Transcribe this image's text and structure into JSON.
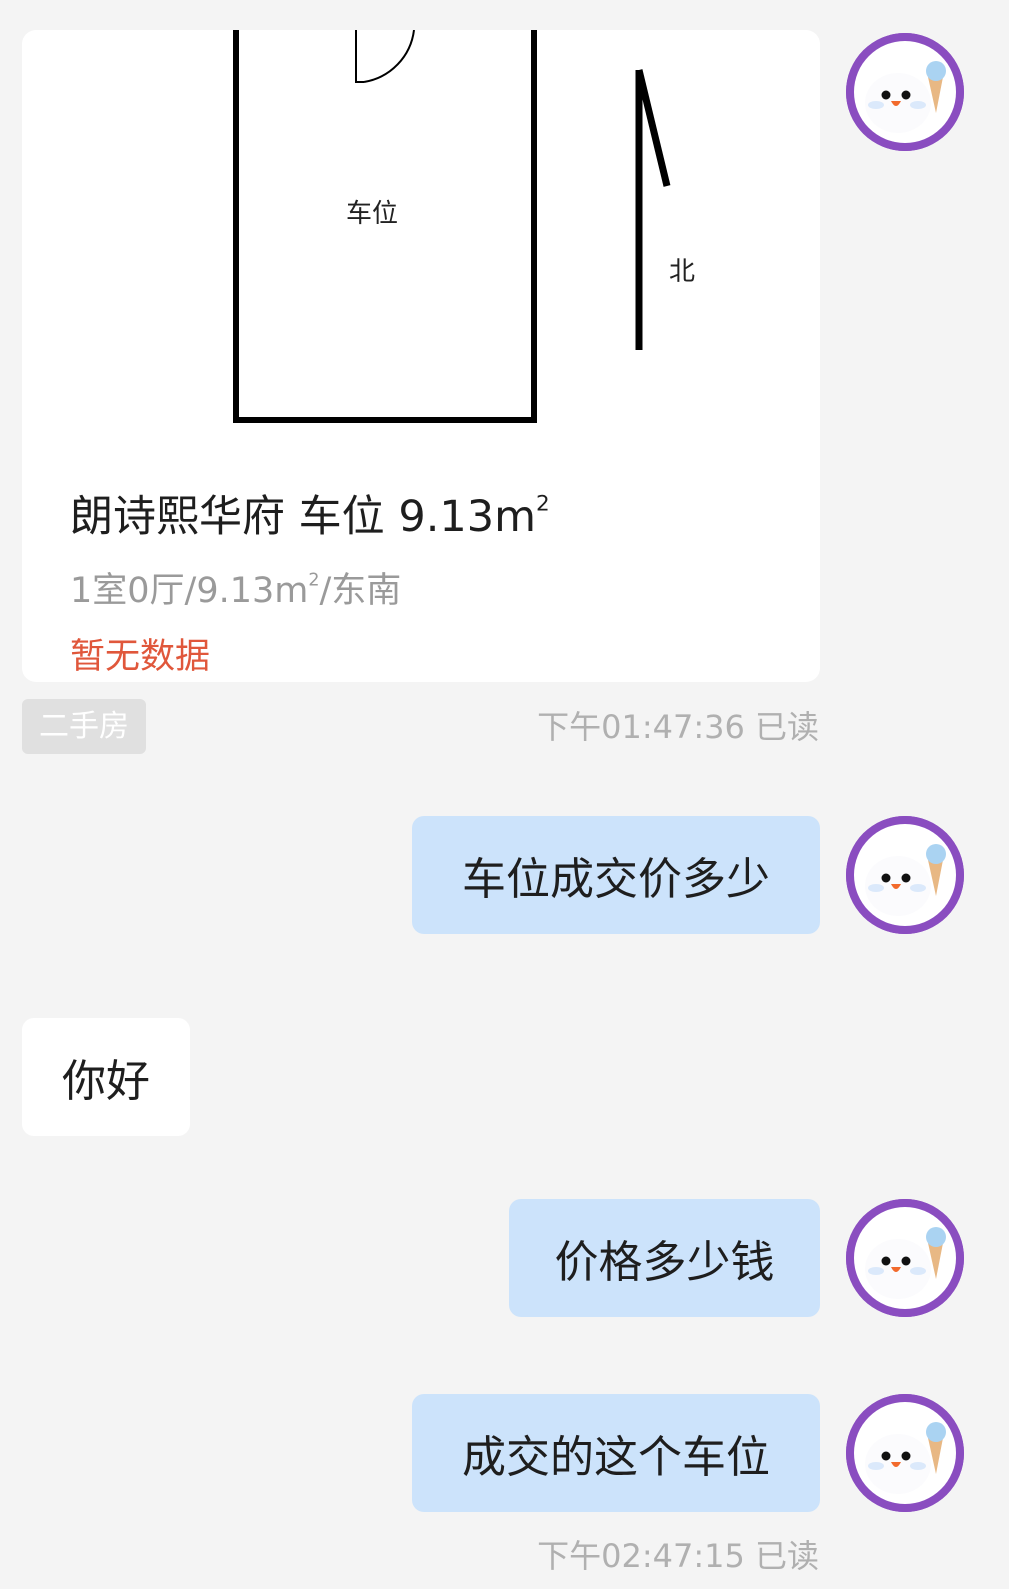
{
  "listing": {
    "plan_label": "车位",
    "north_label": "北",
    "title": "朗诗熙华府 车位 9.13m",
    "title_sup": "2",
    "sub_a": "1室0厅/9.13m",
    "sub_sup": "2",
    "sub_b": "/东南",
    "price": "暂无数据",
    "tag": "二手房"
  },
  "messages": [
    {
      "from": "me",
      "text": "车位成交价多少"
    },
    {
      "from": "them",
      "text": "你好"
    },
    {
      "from": "me",
      "text": "价格多少钱"
    },
    {
      "from": "me",
      "text": "成交的这个车位"
    }
  ],
  "timestamps": {
    "first": "下午01:47:36 已读",
    "last": "下午02:47:15 已读"
  },
  "colors": {
    "page_bg": "#f4f4f4",
    "my_bubble": "#cce3fb",
    "their_bubble": "#ffffff",
    "price_red": "#e0573b",
    "avatar_ring": "#8a4dc0"
  },
  "icons": {
    "avatar": "cartoon-ghost-with-ice-cream-avatar"
  }
}
